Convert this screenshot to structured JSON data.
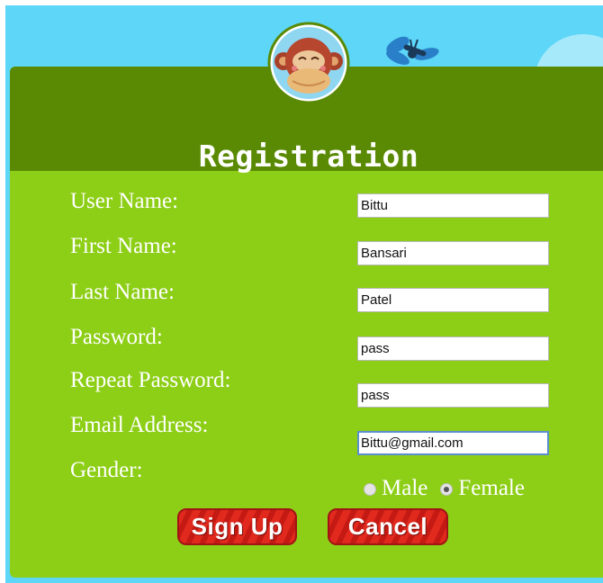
{
  "form": {
    "title": "Registration",
    "labels": {
      "user_name": "User Name:",
      "first_name": "First Name:",
      "last_name": "Last Name:",
      "password": "Password:",
      "repeat_password": "Repeat Password:",
      "email": "Email Address:",
      "gender": "Gender:"
    },
    "values": {
      "user_name": "Bittu",
      "first_name": "Bansari",
      "last_name": "Patel",
      "password": "pass",
      "repeat_password": "pass",
      "email": "Bittu@gmail.com"
    },
    "gender": {
      "options": [
        "Male",
        "Female"
      ],
      "selected": "Female"
    },
    "buttons": {
      "sign_up": "Sign Up",
      "cancel": "Cancel"
    }
  },
  "icons": {
    "mascot": "monkey-logo-icon",
    "decoration": "dragonfly-icon",
    "background": "cloud-shape"
  },
  "colors": {
    "sky": "#5dd6f7",
    "header_green": "#5a8a04",
    "form_green": "#8dce16",
    "button_red": "#e1291e"
  }
}
